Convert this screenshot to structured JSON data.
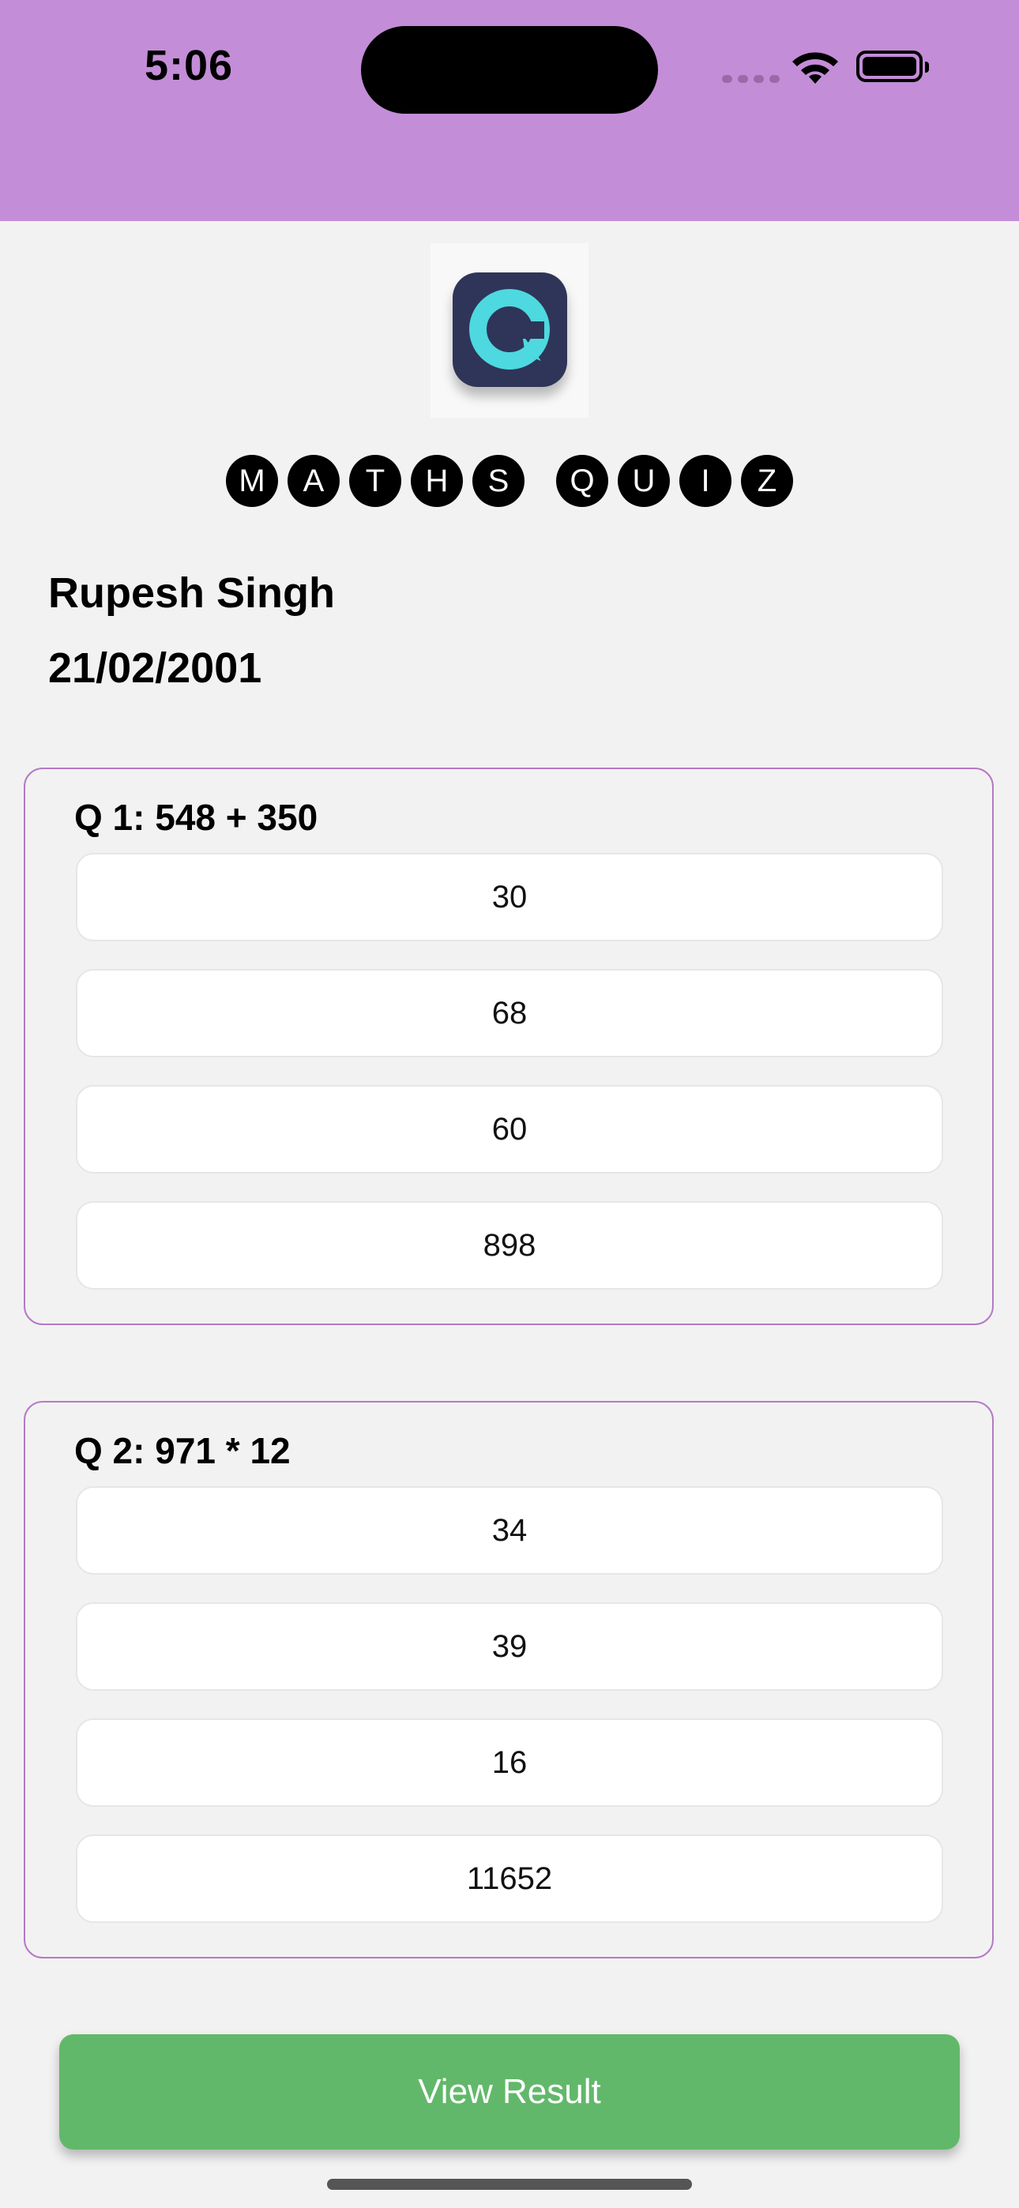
{
  "status_bar": {
    "time": "5:06",
    "background": "#c48dd8"
  },
  "app": {
    "logo_icon": "quiz-q-logo",
    "title_letters": [
      "M",
      "A",
      "T",
      "H",
      "S",
      "",
      "Q",
      "U",
      "I",
      "Z"
    ],
    "user_name": "Rupesh Singh",
    "user_dob": "21/02/2001"
  },
  "questions": [
    {
      "text": "Q 1: 548 + 350",
      "options": [
        "30",
        "68",
        "60",
        "898"
      ]
    },
    {
      "text": "Q 2: 971 * 12",
      "options": [
        "34",
        "39",
        "16",
        "11652"
      ]
    }
  ],
  "actions": {
    "view_result_label": "View Result",
    "button_color": "#62b86a"
  },
  "colors": {
    "accent": "#c48dd8",
    "card_border": "#b579c7"
  }
}
